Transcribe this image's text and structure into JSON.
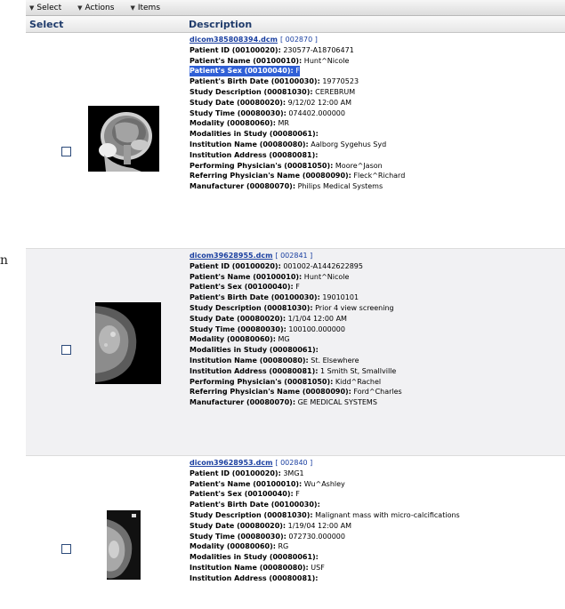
{
  "toolbar": {
    "menus": [
      "Select",
      "Actions",
      "Items"
    ]
  },
  "columns": {
    "select": "Select",
    "description": "Description"
  },
  "side_mark": "n",
  "records": [
    {
      "filename": "dicom385808394.dcm",
      "id": "[ 002870 ]",
      "thumbnail": "mri-head-sagittal",
      "fields": [
        {
          "label": "Patient ID (00100020):",
          "value": "230577-A18706471"
        },
        {
          "label": "Patient's Name (00100010):",
          "value": "Hunt^Nicole"
        },
        {
          "label": "Patient's Sex (00100040):",
          "value": "F",
          "highlight": true
        },
        {
          "label": "Patient's Birth Date (00100030):",
          "value": "19770523"
        },
        {
          "label": "Study Description (00081030):",
          "value": "CEREBRUM"
        },
        {
          "label": "Study Date (00080020):",
          "value": "9/12/02 12:00 AM"
        },
        {
          "label": "Study Time (00080030):",
          "value": "074402.000000"
        },
        {
          "label": "Modality (00080060):",
          "value": "MR"
        },
        {
          "label": "Modalities in Study (00080061):",
          "value": ""
        },
        {
          "label": "Institution Name (00080080):",
          "value": "Aalborg Sygehus Syd"
        },
        {
          "label": "Institution Address (00080081):",
          "value": ""
        },
        {
          "label": "Performing Physician's (00081050):",
          "value": "Moore^Jason"
        },
        {
          "label": "Referring Physician's Name (00080090):",
          "value": "Fleck^Richard"
        },
        {
          "label": "Manufacturer (00080070):",
          "value": "Philips Medical Systems"
        }
      ]
    },
    {
      "filename": "dicom39628955.dcm",
      "id": "[ 002841 ]",
      "thumbnail": "mammogram-craniocaudal",
      "fields": [
        {
          "label": "Patient ID (00100020):",
          "value": "001002-A1442622895"
        },
        {
          "label": "Patient's Name (00100010):",
          "value": "Hunt^Nicole"
        },
        {
          "label": "Patient's Sex (00100040):",
          "value": "F"
        },
        {
          "label": "Patient's Birth Date (00100030):",
          "value": "19010101"
        },
        {
          "label": "Study Description (00081030):",
          "value": "Prior 4 view screening"
        },
        {
          "label": "Study Date (00080020):",
          "value": "1/1/04 12:00 AM"
        },
        {
          "label": "Study Time (00080030):",
          "value": "100100.000000"
        },
        {
          "label": "Modality (00080060):",
          "value": "MG"
        },
        {
          "label": "Modalities in Study (00080061):",
          "value": ""
        },
        {
          "label": "Institution Name (00080080):",
          "value": "St. Elsewhere"
        },
        {
          "label": "Institution Address (00080081):",
          "value": "1 Smith St, Smallville"
        },
        {
          "label": "Performing Physician's (00081050):",
          "value": "Kidd^Rachel"
        },
        {
          "label": "Referring Physician's Name (00080090):",
          "value": "Ford^Charles"
        },
        {
          "label": "Manufacturer (00080070):",
          "value": "GE MEDICAL SYSTEMS"
        }
      ]
    },
    {
      "filename": "dicom39628953.dcm",
      "id": "[ 002840 ]",
      "thumbnail": "mammogram-lateral",
      "fields": [
        {
          "label": "Patient ID (00100020):",
          "value": "3MG1"
        },
        {
          "label": "Patient's Name (00100010):",
          "value": "Wu^Ashley"
        },
        {
          "label": "Patient's Sex (00100040):",
          "value": "F"
        },
        {
          "label": "Patient's Birth Date (00100030):",
          "value": ""
        },
        {
          "label": "Study Description (00081030):",
          "value": "Malignant mass with micro-calcifications"
        },
        {
          "label": "Study Date (00080020):",
          "value": "1/19/04 12:00 AM"
        },
        {
          "label": "Study Time (00080030):",
          "value": "072730.000000"
        },
        {
          "label": "Modality (00080060):",
          "value": "RG"
        },
        {
          "label": "Modalities in Study (00080061):",
          "value": ""
        },
        {
          "label": "Institution Name (00080080):",
          "value": "USF"
        },
        {
          "label": "Institution Address (00080081):",
          "value": ""
        }
      ]
    }
  ]
}
